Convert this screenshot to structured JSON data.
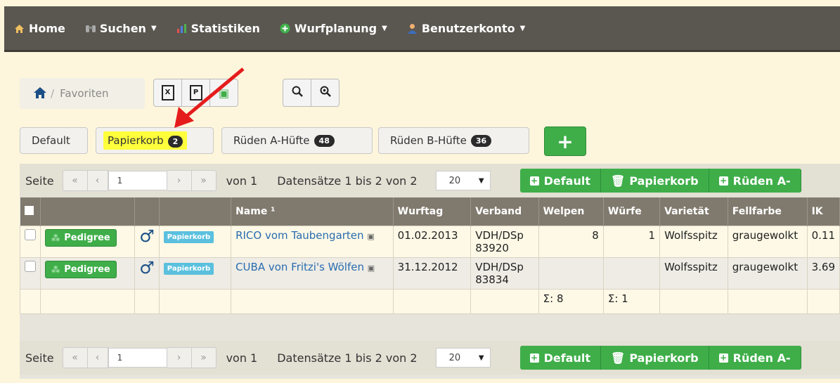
{
  "nav": {
    "items": [
      {
        "label": "Home",
        "icon": "home-icon",
        "caret": false
      },
      {
        "label": "Suchen",
        "icon": "binoculars-icon",
        "caret": true
      },
      {
        "label": "Statistiken",
        "icon": "chart-icon",
        "caret": false
      },
      {
        "label": "Wurfplanung",
        "icon": "plus-circle-icon",
        "caret": true
      },
      {
        "label": "Benutzerkonto",
        "icon": "user-icon",
        "caret": true
      }
    ]
  },
  "breadcrumb": {
    "label": "Favoriten",
    "separator": "/"
  },
  "toolbar": {
    "excel": "X",
    "pdf": "P",
    "csv": "▣",
    "search": "🔍",
    "zoom": "⊕"
  },
  "tabs": [
    {
      "label": "Default",
      "count": ""
    },
    {
      "label": "Papierkorb",
      "count": "2"
    },
    {
      "label": "Rüden A-Hüfte",
      "count": "48"
    },
    {
      "label": "Rüden B-Hüfte",
      "count": "36"
    }
  ],
  "add_button": "+",
  "pager": {
    "seite": "Seite",
    "first": "«",
    "prev": "‹",
    "page": "1",
    "next": "›",
    "last": "»",
    "von": "von 1",
    "records": "Datensätze 1 bis 2 von 2",
    "per_page": "20",
    "actions": [
      {
        "label": "Default",
        "icon": "plus-square-icon"
      },
      {
        "label": "Papierkorb",
        "icon": "trash-icon"
      },
      {
        "label": "Rüden A-",
        "icon": "plus-square-icon"
      }
    ]
  },
  "table": {
    "headers": [
      "",
      "",
      "",
      "",
      "Name ¹",
      "Wurftag",
      "Verband",
      "Welpen",
      "Würfe",
      "Varietät",
      "Fellfarbe",
      "IK"
    ],
    "rows": [
      {
        "pedigree": "Pedigree",
        "sex": "♂",
        "tag": "Papierkorb",
        "name": "RICO vom Taubengarten",
        "wurftag": "01.02.2013",
        "verband": "VDH/DSp 83920",
        "welpen": "8",
        "wuerfe": "1",
        "varietaet": "Wolfsspitz",
        "fellfarbe": "graugewolkt",
        "ik": "0.11"
      },
      {
        "pedigree": "Pedigree",
        "sex": "♂",
        "tag": "Papierkorb",
        "name": "CUBA von Fritzi's Wölfen",
        "wurftag": "31.12.2012",
        "verband": "VDH/DSp 83834",
        "welpen": "",
        "wuerfe": "",
        "varietaet": "Wolfsspitz",
        "fellfarbe": "graugewolkt",
        "ik": "3.69"
      }
    ],
    "sums": {
      "welpen": "Σ: 8",
      "wuerfe": "Σ: 1"
    }
  },
  "colors": {
    "nav": "#5a5650",
    "green": "#3fae49",
    "header": "#807a6e",
    "highlight": "#ffff3c",
    "arrow": "#e51c1c"
  }
}
